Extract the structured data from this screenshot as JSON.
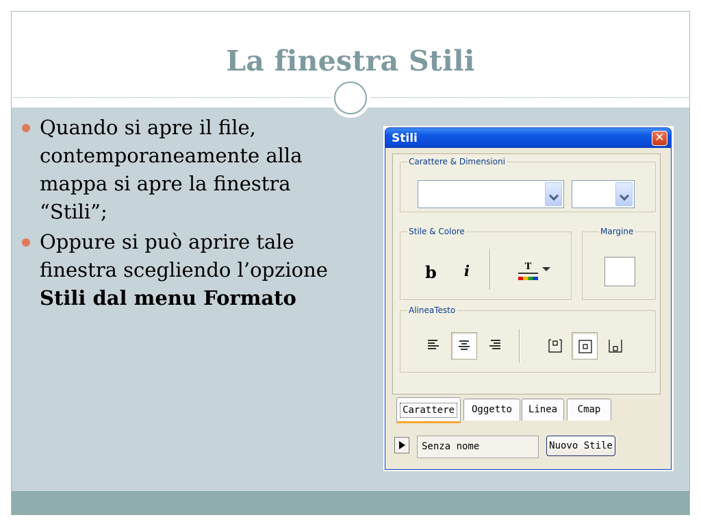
{
  "slide": {
    "title": "La finestra Stili",
    "bullets": [
      {
        "text": "Quando si apre il file, contemporaneamente alla mappa si apre la finestra “Stili”;"
      },
      {
        "text": "Oppure si può aprire tale finestra scegliendo l’opzione ",
        "bold": "Stili dal menu Formato"
      }
    ]
  },
  "stili_window": {
    "title": "Stili",
    "close_label": "✕",
    "font_section": {
      "legend": "Carattere & Dimensioni",
      "font_value": "",
      "size_value": ""
    },
    "style_section": {
      "legend": "Stile & Colore",
      "bold_label": "b",
      "italic_label": "i",
      "text_color_label": "T"
    },
    "margin_section": {
      "legend": "Margine"
    },
    "align_section": {
      "legend": "AlineaTesto"
    },
    "tabs": [
      "Carattere",
      "Oggetto",
      "Linea",
      "Cmap"
    ],
    "active_tab": "Carattere",
    "style_name": "Senza nome",
    "new_style_label": "Nuovo Stile"
  },
  "colors": {
    "title": "#7e9a9f",
    "body_background": "#c6d3d8",
    "footer_bar": "#8eadac",
    "bullet_dot": "#e07a5b",
    "window_titlebar": "#0a4ad6",
    "active_tab_accent": "#f7a638"
  }
}
